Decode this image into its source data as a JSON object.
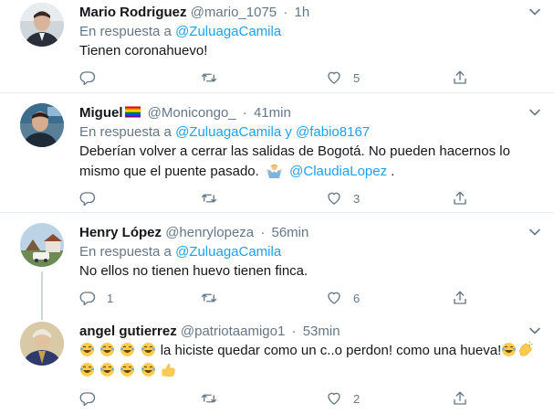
{
  "tweets": [
    {
      "name": "Mario Rodriguez",
      "handle": "@mario_1075",
      "time": "1h",
      "reply_prefix": "En respuesta a",
      "reply_to": "@ZuluagaCamila",
      "text": "Tienen coronahuevo!",
      "replies": "",
      "likes": "5"
    },
    {
      "name": "Miguel",
      "handle": "@Monicongo_",
      "time": "41min",
      "reply_prefix": "En respuesta a",
      "reply_to": "@ZuluagaCamila y @fabio8167",
      "text": "Deberían volver a cerrar las salidas de Bogotá. No pueden hacernos lo",
      "text2": "mismo que el puente pasado.",
      "mention": "@ClaudiaLopez",
      "text_end": ".",
      "replies": "",
      "likes": "3"
    },
    {
      "name": "Henry López",
      "handle": "@henrylopeza",
      "time": "56min",
      "reply_prefix": "En respuesta a",
      "reply_to": "@ZuluagaCamila",
      "text": "No ellos no tienen huevo tienen finca.",
      "replies": "1",
      "likes": "6"
    },
    {
      "name": "angel gutierrez",
      "handle": "@patriotaamigo1",
      "time": "53min",
      "text": "la hiciste quedar como un c..o perdon! como una hueva!",
      "replies": "",
      "likes": "2"
    }
  ],
  "icons": {
    "reply": "reply-icon",
    "retweet": "retweet-icon",
    "like": "heart-icon",
    "share": "share-icon",
    "more": "chevron-down-icon"
  },
  "colors": {
    "link": "#1da1f2",
    "muted": "#657786",
    "divider": "#e6ecf0"
  }
}
